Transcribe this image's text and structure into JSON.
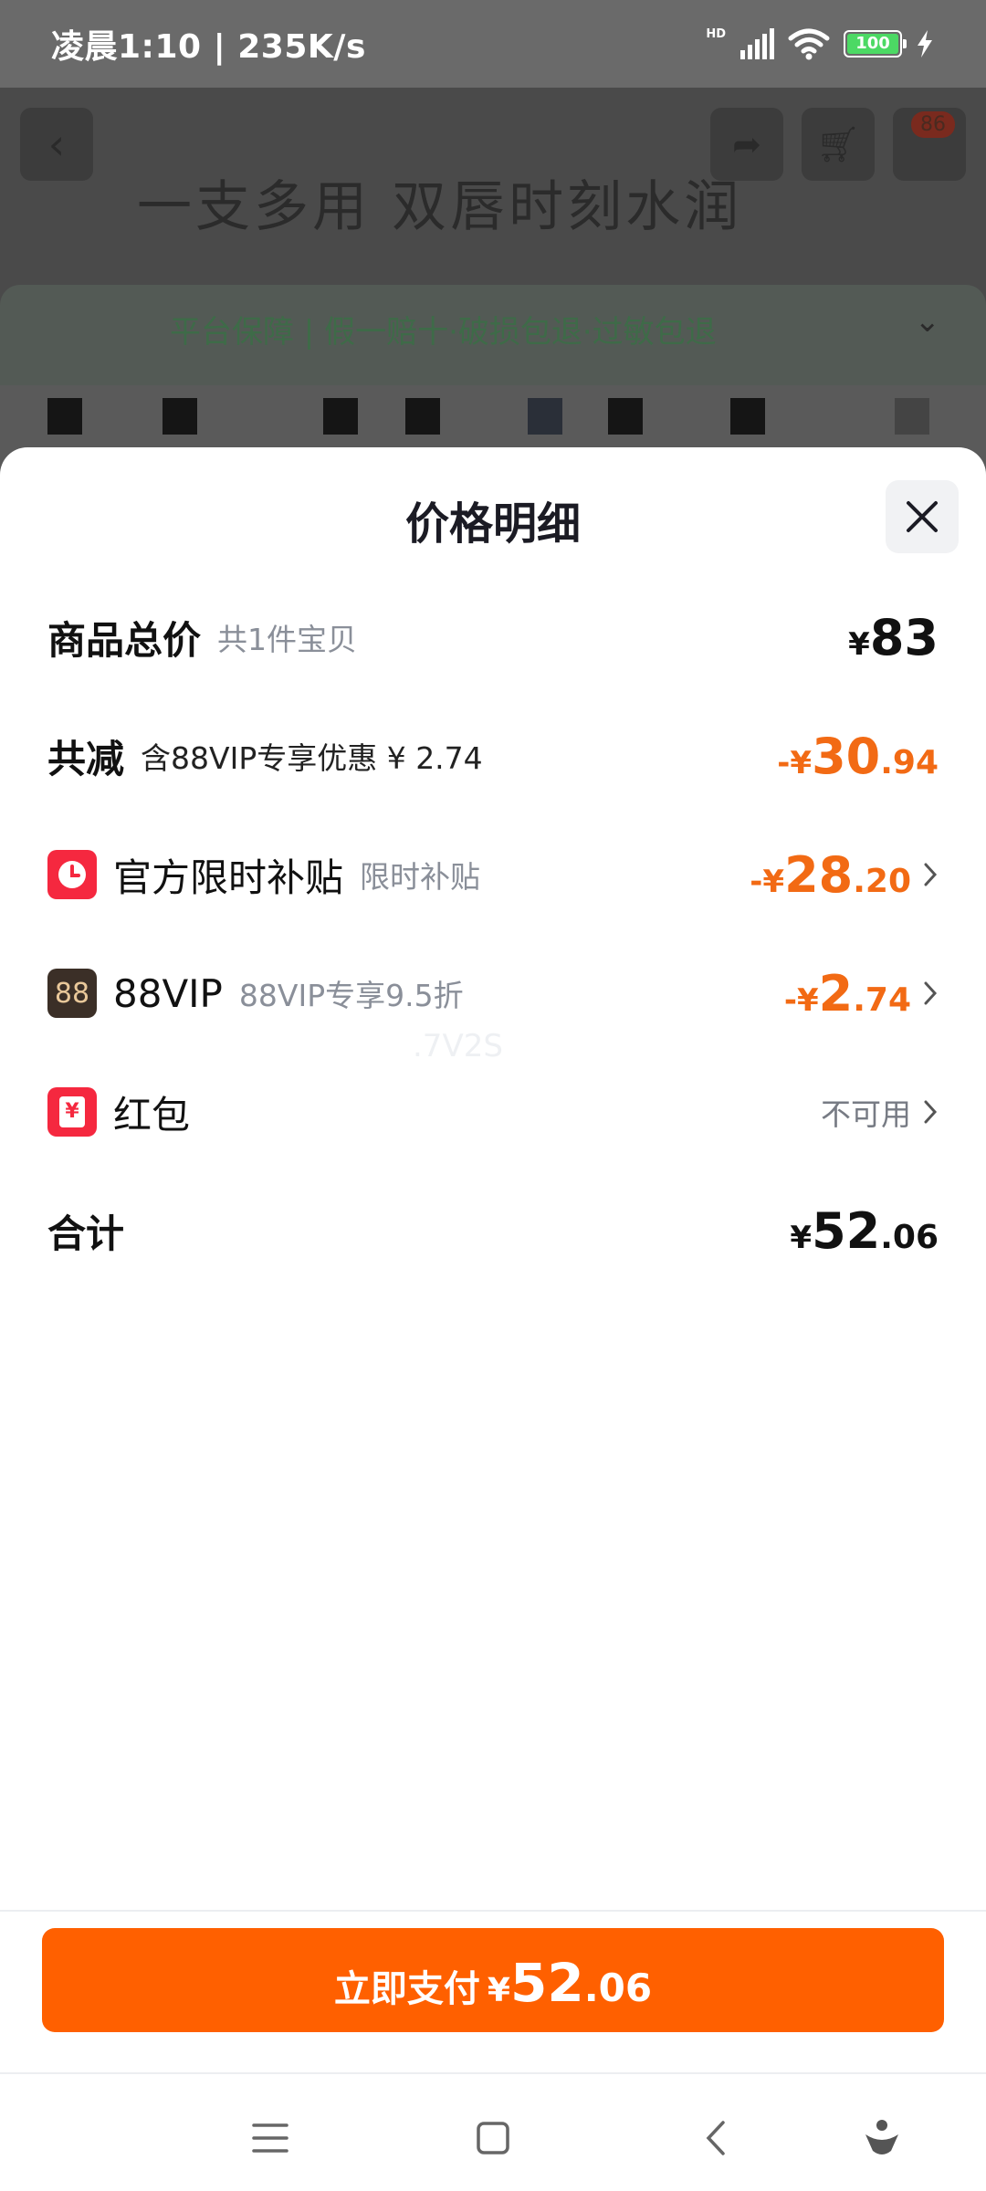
{
  "status_bar": {
    "time": "凌晨1:10 | 235K/s",
    "hd": "HD",
    "battery": "100"
  },
  "background": {
    "slogan": "一支多用 双唇时刻水润",
    "guarantee": "平台保障 | 假一赔十·破损包退·过敏包退",
    "cart_badge": "86"
  },
  "sheet": {
    "title": "价格明细",
    "rows": [
      {
        "label": "商品总价",
        "sub": "共1件宝贝",
        "currency": "¥",
        "amount": "83",
        "decimal": ""
      },
      {
        "label": "共减",
        "sub": "含88VIP专享优惠 ¥ 2.74",
        "sign": "-",
        "currency": "¥",
        "amount": "30",
        "decimal": ".94"
      },
      {
        "label": "官方限时补贴",
        "sub": "限时补贴",
        "sign": "-",
        "currency": "¥",
        "amount": "28",
        "decimal": ".20",
        "icon": "clock-icon"
      },
      {
        "label": "88VIP",
        "sub": "88VIP专享9.5折",
        "sign": "-",
        "currency": "¥",
        "amount": "2",
        "decimal": ".74",
        "icon": "vip88-icon",
        "icon_text": "88"
      },
      {
        "label": "红包",
        "status": "不可用",
        "icon": "red-envelope-icon",
        "icon_text": "¥"
      },
      {
        "label": "合计",
        "currency": "¥",
        "amount": "52",
        "decimal": ".06"
      }
    ],
    "watermark": ".7V2S"
  },
  "pay_button": {
    "label": "立即支付",
    "currency": "¥",
    "amount": "52",
    "decimal": ".06"
  },
  "colors": {
    "accent": "#ff6000",
    "discount": "#f26a14",
    "subsidy_icon": "#f5283f",
    "vip_icon": "#3b2f27"
  }
}
